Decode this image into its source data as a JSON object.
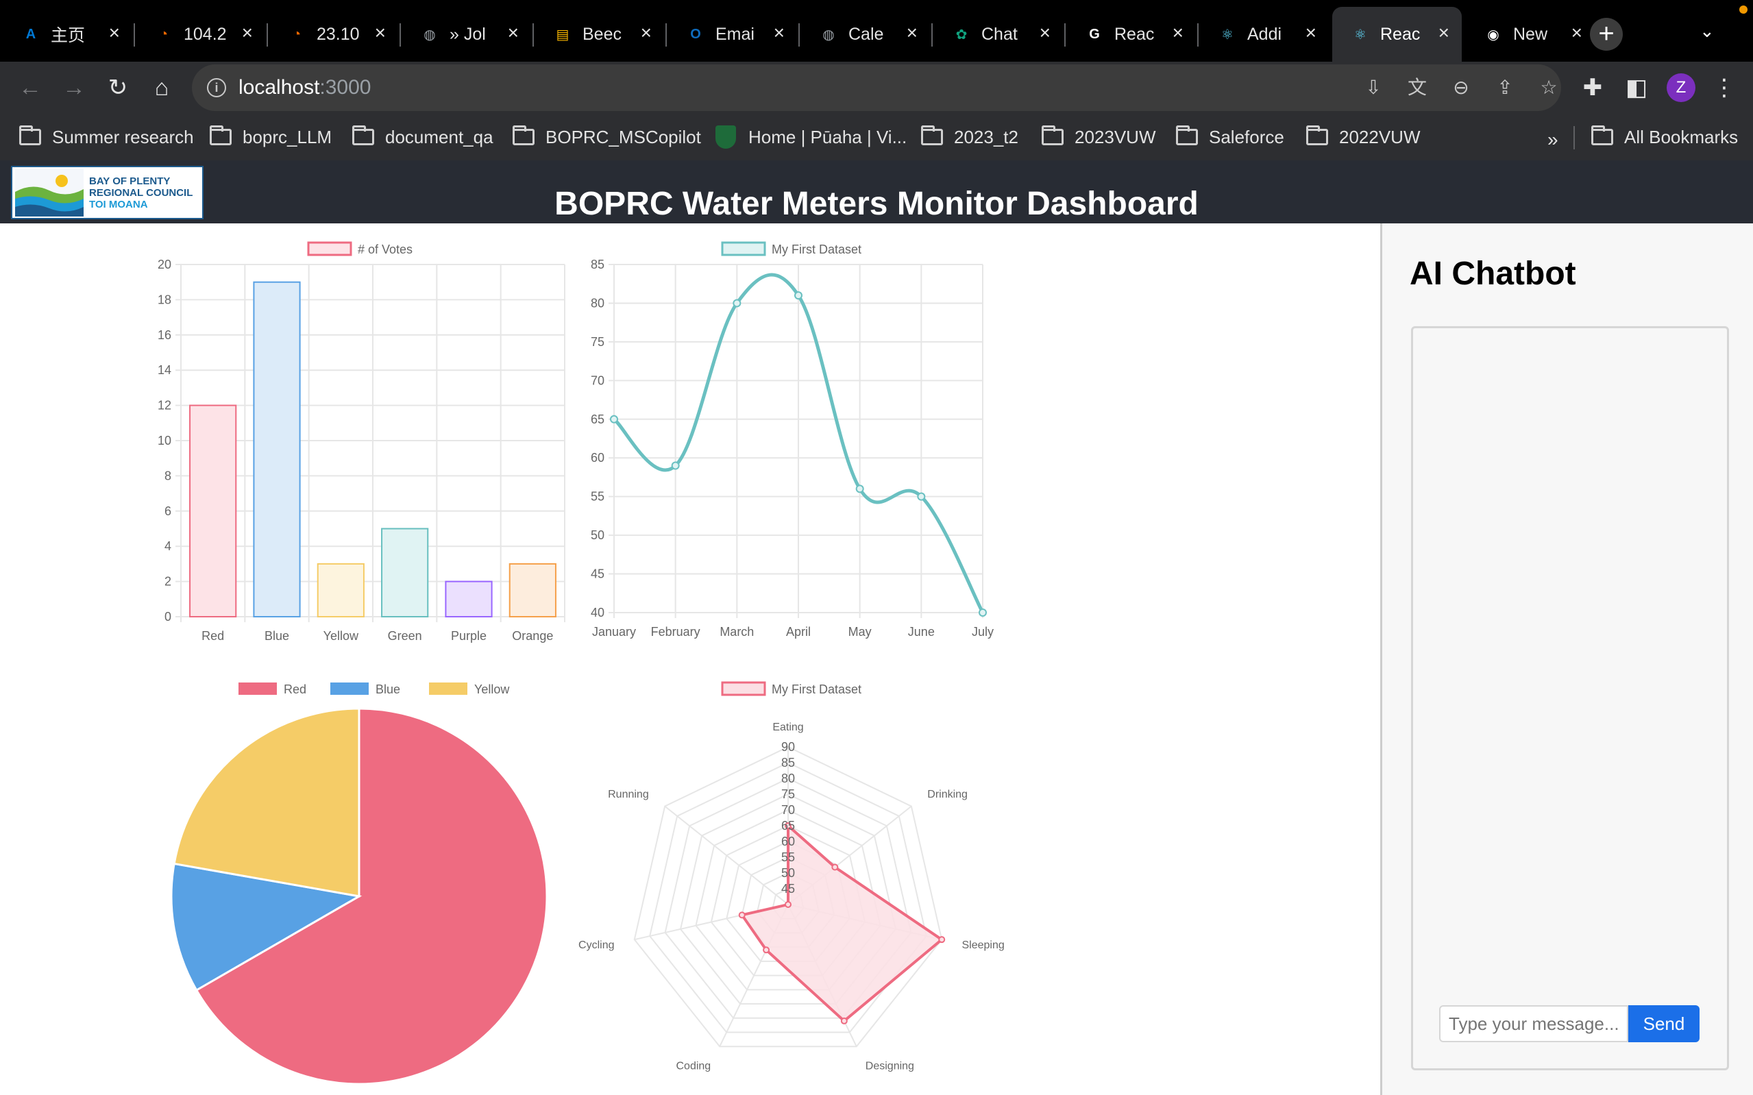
{
  "browser": {
    "tabs": [
      {
        "title": "主页",
        "icon": "azure-icon",
        "color": "#0078d4",
        "glyph": "A"
      },
      {
        "title": "104.2",
        "icon": "grafana-icon",
        "color": "#f46800",
        "glyph": "◔"
      },
      {
        "title": "23.10",
        "icon": "grafana-icon",
        "color": "#f46800",
        "glyph": "◔"
      },
      {
        "title": "» Jol",
        "icon": "globe-icon",
        "color": "#9aa0a6",
        "glyph": "◍"
      },
      {
        "title": "Beec",
        "icon": "beeceptor-icon",
        "color": "#f7b500",
        "glyph": "▤"
      },
      {
        "title": "Emai",
        "icon": "outlook-icon",
        "color": "#0f6cbd",
        "glyph": "O"
      },
      {
        "title": "Cale",
        "icon": "globe-icon",
        "color": "#9aa0a6",
        "glyph": "◍"
      },
      {
        "title": "Chat",
        "icon": "chatgpt-icon",
        "color": "#10a37f",
        "glyph": "✿"
      },
      {
        "title": "Reac",
        "icon": "google-icon",
        "color": "#ffffff",
        "glyph": "G"
      },
      {
        "title": "Addi",
        "icon": "react-icon",
        "color": "#61dafb",
        "glyph": "⚛"
      },
      {
        "title": "Reac",
        "icon": "react-icon",
        "color": "#61dafb",
        "glyph": "⚛",
        "active": true
      },
      {
        "title": "New",
        "icon": "chrome-icon",
        "color": "#ffffff",
        "glyph": "◉"
      }
    ],
    "new_tab_label": "+",
    "url_host": "localhost",
    "url_port": ":3000",
    "profile_initial": "Z",
    "bookmarks": [
      {
        "label": "Summer research",
        "type": "folder"
      },
      {
        "label": "boprc_LLM",
        "type": "folder"
      },
      {
        "label": "document_qa",
        "type": "folder"
      },
      {
        "label": "BOPRC_MSCopilot",
        "type": "folder"
      },
      {
        "label": "Home | Pūaha | Vi...",
        "type": "site"
      },
      {
        "label": "2023_t2",
        "type": "folder"
      },
      {
        "label": "2023VUW",
        "type": "folder"
      },
      {
        "label": "Saleforce",
        "type": "folder"
      },
      {
        "label": "2022VUW",
        "type": "folder"
      }
    ],
    "bookmarks_overflow": "»",
    "all_bookmarks_label": "All Bookmarks"
  },
  "app": {
    "title": "BOPRC Water Meters Monitor Dashboard",
    "logo_lines": [
      "BAY OF PLENTY",
      "REGIONAL COUNCIL",
      "TOI MOANA"
    ],
    "chat": {
      "title": "AI Chatbot",
      "input_placeholder": "Type your message...",
      "send_label": "Send"
    }
  },
  "chart_data": [
    {
      "type": "bar",
      "legend": [
        "# of Votes"
      ],
      "categories": [
        "Red",
        "Blue",
        "Yellow",
        "Green",
        "Purple",
        "Orange"
      ],
      "values": [
        12,
        19,
        3,
        5,
        2,
        3
      ],
      "fill_colors": [
        "#fde3e7",
        "#dcebf9",
        "#fdf4de",
        "#e0f3f3",
        "#ebe0fe",
        "#fdeddd"
      ],
      "border_colors": [
        "#ee6b81",
        "#58a1e4",
        "#f5cc67",
        "#67bfbf",
        "#9966ff",
        "#f5a04a"
      ],
      "ylim": [
        0,
        20
      ],
      "yticks": [
        0,
        2,
        4,
        6,
        8,
        10,
        12,
        14,
        16,
        18,
        20
      ],
      "grid": true
    },
    {
      "type": "line",
      "legend": [
        "My First Dataset"
      ],
      "categories": [
        "January",
        "February",
        "March",
        "April",
        "May",
        "June",
        "July"
      ],
      "values": [
        65,
        59,
        80,
        81,
        56,
        55,
        40
      ],
      "color": "#6ac0c1",
      "ylim": [
        40,
        85
      ],
      "yticks": [
        40,
        45,
        50,
        55,
        60,
        65,
        70,
        75,
        80,
        85
      ],
      "grid": true
    },
    {
      "type": "pie",
      "legend": [
        "Red",
        "Blue",
        "Yellow"
      ],
      "values": [
        300,
        50,
        100
      ],
      "colors": [
        "#ee6b81",
        "#58a1e4",
        "#f5cc67"
      ]
    },
    {
      "type": "radar",
      "legend": [
        "My First Dataset"
      ],
      "categories": [
        "Eating",
        "Drinking",
        "Sleeping",
        "Designing",
        "Coding",
        "Cycling",
        "Running"
      ],
      "values": [
        65,
        59,
        90,
        81,
        56,
        55,
        40
      ],
      "color": "#ee6b81",
      "fill": "#fbdfe4",
      "rlim": [
        40,
        90
      ],
      "ticks": [
        45,
        50,
        55,
        60,
        65,
        70,
        75,
        80,
        85,
        90
      ]
    }
  ]
}
